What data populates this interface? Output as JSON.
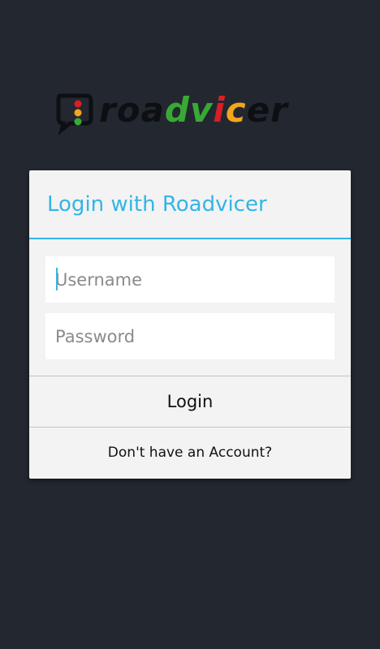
{
  "app": {
    "logo_text": "roadvicer",
    "accent_color": "#33b5e5",
    "background_color": "#232830"
  },
  "dialog": {
    "title": "Login with Roadvicer",
    "username": {
      "value": "",
      "placeholder": "Username"
    },
    "password": {
      "value": "",
      "placeholder": "Password"
    },
    "login_button_label": "Login",
    "signup_link_label": "Don't have an Account?"
  },
  "icons": {
    "logo": "roadvicer-logo-icon"
  }
}
